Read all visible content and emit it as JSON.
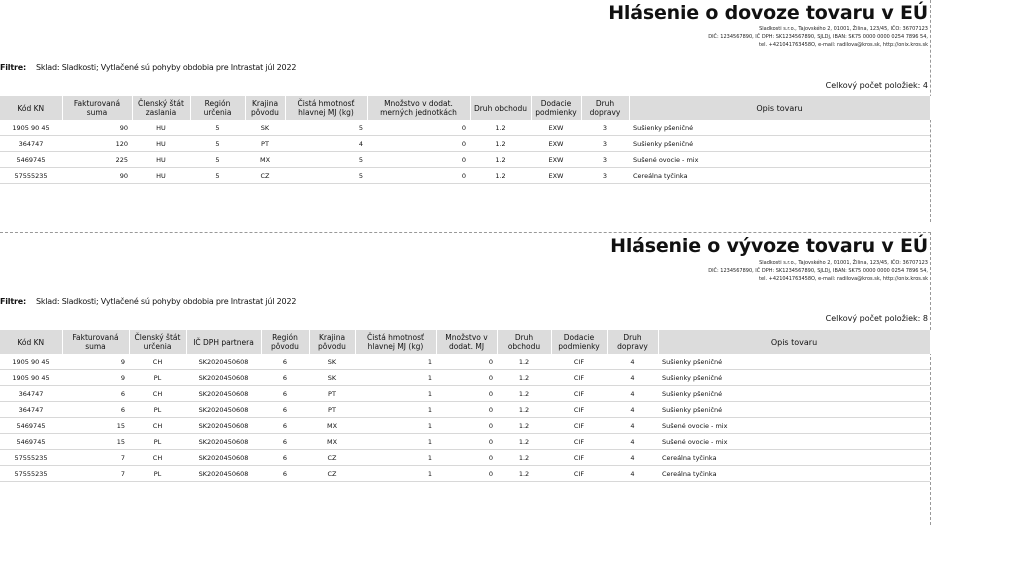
{
  "import": {
    "title": "Hlásenie o dovoze tovaru v EÚ",
    "company_line1": "Sladkosti s.r.o., Tajovského 2, 01001, Žilina, 123/45, IČO: 36707123",
    "company_line2": "DIČ: 1234567890, IČ DPH: SK1234567890, SJLDj, IBAN: SK75 0000 0000 0254 7896 54,",
    "company_line3": "tel. +421041763458O, e-mail: radilova@kros.sk, http://onix.kros.sk",
    "filter_label": "Filtre:",
    "filter_text": "Sklad: Sladkosti; Vytlačené sú pohyby obdobia pre Intrastat júl 2022",
    "count_text": "Celkový počet položiek: 4",
    "headers": [
      "Kód KN",
      "Fakturovaná suma",
      "Členský štát zaslania",
      "Región určenia",
      "Krajina pôvodu",
      "Čistá hmotnosť hlavnej MJ (kg)",
      "Množstvo v dodat. merných jednotkách",
      "Druh obchodu",
      "Dodacie podmienky",
      "Druh dopravy",
      "Opis tovaru"
    ],
    "rows": [
      [
        "1905 90 45",
        "90",
        "HU",
        "5",
        "SK",
        "5",
        "0",
        "1.2",
        "EXW",
        "3",
        "Sušienky pšeničné"
      ],
      [
        "364747",
        "120",
        "HU",
        "5",
        "PT",
        "4",
        "0",
        "1.2",
        "EXW",
        "3",
        "Sušienky pšeničné"
      ],
      [
        "5469745",
        "225",
        "HU",
        "5",
        "MX",
        "5",
        "0",
        "1.2",
        "EXW",
        "3",
        "Sušené ovocie - mix"
      ],
      [
        "57555235",
        "90",
        "HU",
        "5",
        "CZ",
        "5",
        "0",
        "1.2",
        "EXW",
        "3",
        "Cereálna tyčinka"
      ]
    ]
  },
  "export": {
    "title": "Hlásenie o vývoze tovaru v EÚ",
    "company_line1": "Sladkosti s.r.o., Tajovského 2, 01001, Žilina, 123/45, IČO: 36707123",
    "company_line2": "DIČ: 1234567890, IČ DPH: SK1234567890, SJLDj, IBAN: SK75 0000 0000 0254 7896 54,",
    "company_line3": "tel. +421041763458O, e-mail: radilova@kros.sk, http://onix.kros.sk",
    "filter_label": "Filtre:",
    "filter_text": "Sklad: Sladkosti; Vytlačené sú pohyby obdobia pre Intrastat júl 2022",
    "count_text": "Celkový počet položiek: 8",
    "headers": [
      "Kód KN",
      "Fakturovaná suma",
      "Členský štát určenia",
      "IČ DPH partnera",
      "Región pôvodu",
      "Krajina pôvodu",
      "Čistá hmotnosť hlavnej MJ (kg)",
      "Množstvo v dodat. MJ",
      "Druh obchodu",
      "Dodacie podmienky",
      "Druh dopravy",
      "Opis tovaru"
    ],
    "rows": [
      [
        "1905 90 45",
        "9",
        "CH",
        "SK2020450608",
        "6",
        "SK",
        "1",
        "0",
        "1.2",
        "CIF",
        "4",
        "Sušienky pšeničné"
      ],
      [
        "1905 90 45",
        "9",
        "PL",
        "SK2020450608",
        "6",
        "SK",
        "1",
        "0",
        "1.2",
        "CIF",
        "4",
        "Sušienky pšeničné"
      ],
      [
        "364747",
        "6",
        "CH",
        "SK2020450608",
        "6",
        "PT",
        "1",
        "0",
        "1.2",
        "CIF",
        "4",
        "Sušienky pšeničné"
      ],
      [
        "364747",
        "6",
        "PL",
        "SK2020450608",
        "6",
        "PT",
        "1",
        "0",
        "1.2",
        "CIF",
        "4",
        "Sušienky pšeničné"
      ],
      [
        "5469745",
        "15",
        "CH",
        "SK2020450608",
        "6",
        "MX",
        "1",
        "0",
        "1.2",
        "CIF",
        "4",
        "Sušené ovocie - mix"
      ],
      [
        "5469745",
        "15",
        "PL",
        "SK2020450608",
        "6",
        "MX",
        "1",
        "0",
        "1.2",
        "CIF",
        "4",
        "Sušené ovocie - mix"
      ],
      [
        "57555235",
        "7",
        "CH",
        "SK2020450608",
        "6",
        "CZ",
        "1",
        "0",
        "1.2",
        "CIF",
        "4",
        "Cereálna tyčinka"
      ],
      [
        "57555235",
        "7",
        "PL",
        "SK2020450608",
        "6",
        "CZ",
        "1",
        "0",
        "1.2",
        "CIF",
        "4",
        "Cereálna tyčinka"
      ]
    ]
  }
}
